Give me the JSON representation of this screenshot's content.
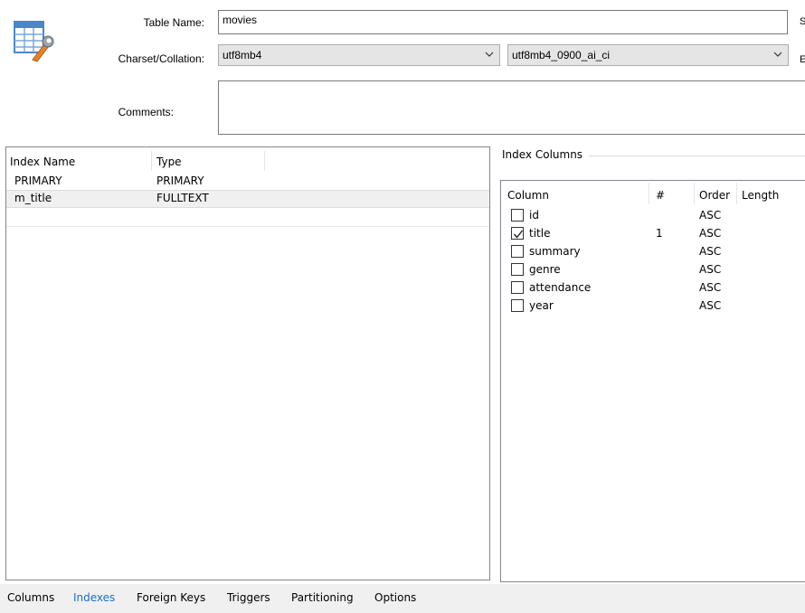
{
  "form": {
    "table_name_label": "Table Name:",
    "table_name_value": "movies",
    "charset_label": "Charset/Collation:",
    "charset_value": "utf8mb4",
    "collation_value": "utf8mb4_0900_ai_ci",
    "comments_label": "Comments:",
    "comments_value": "",
    "edge_label_1": "S",
    "edge_label_2": "E"
  },
  "indexes": {
    "headers": {
      "name": "Index Name",
      "type": "Type"
    },
    "rows": [
      {
        "name": "PRIMARY",
        "type": "PRIMARY",
        "selected": false
      },
      {
        "name": "m_title",
        "type": "FULLTEXT",
        "selected": true
      }
    ]
  },
  "index_columns": {
    "group_title": "Index Columns",
    "headers": {
      "column": "Column",
      "num": "#",
      "order": "Order",
      "length": "Length"
    },
    "rows": [
      {
        "column": "id",
        "checked": false,
        "num": "",
        "order": "ASC"
      },
      {
        "column": "title",
        "checked": true,
        "num": "1",
        "order": "ASC"
      },
      {
        "column": "summary",
        "checked": false,
        "num": "",
        "order": "ASC"
      },
      {
        "column": "genre",
        "checked": false,
        "num": "",
        "order": "ASC"
      },
      {
        "column": "attendance",
        "checked": false,
        "num": "",
        "order": "ASC"
      },
      {
        "column": "year",
        "checked": false,
        "num": "",
        "order": "ASC"
      }
    ]
  },
  "tabs": [
    {
      "label": "Columns",
      "active": false
    },
    {
      "label": "Indexes",
      "active": true
    },
    {
      "label": "Foreign Keys",
      "active": false
    },
    {
      "label": "Triggers",
      "active": false
    },
    {
      "label": "Partitioning",
      "active": false
    },
    {
      "label": "Options",
      "active": false
    }
  ],
  "colors": {
    "active_tab": "#1a6fc9",
    "selected_row": "#f0f0f0",
    "combo_bg": "#e5e5e5"
  },
  "icons": {
    "table": "table-wrench-icon",
    "dropdown": "chevron-down-icon",
    "check": "checkmark-icon"
  }
}
